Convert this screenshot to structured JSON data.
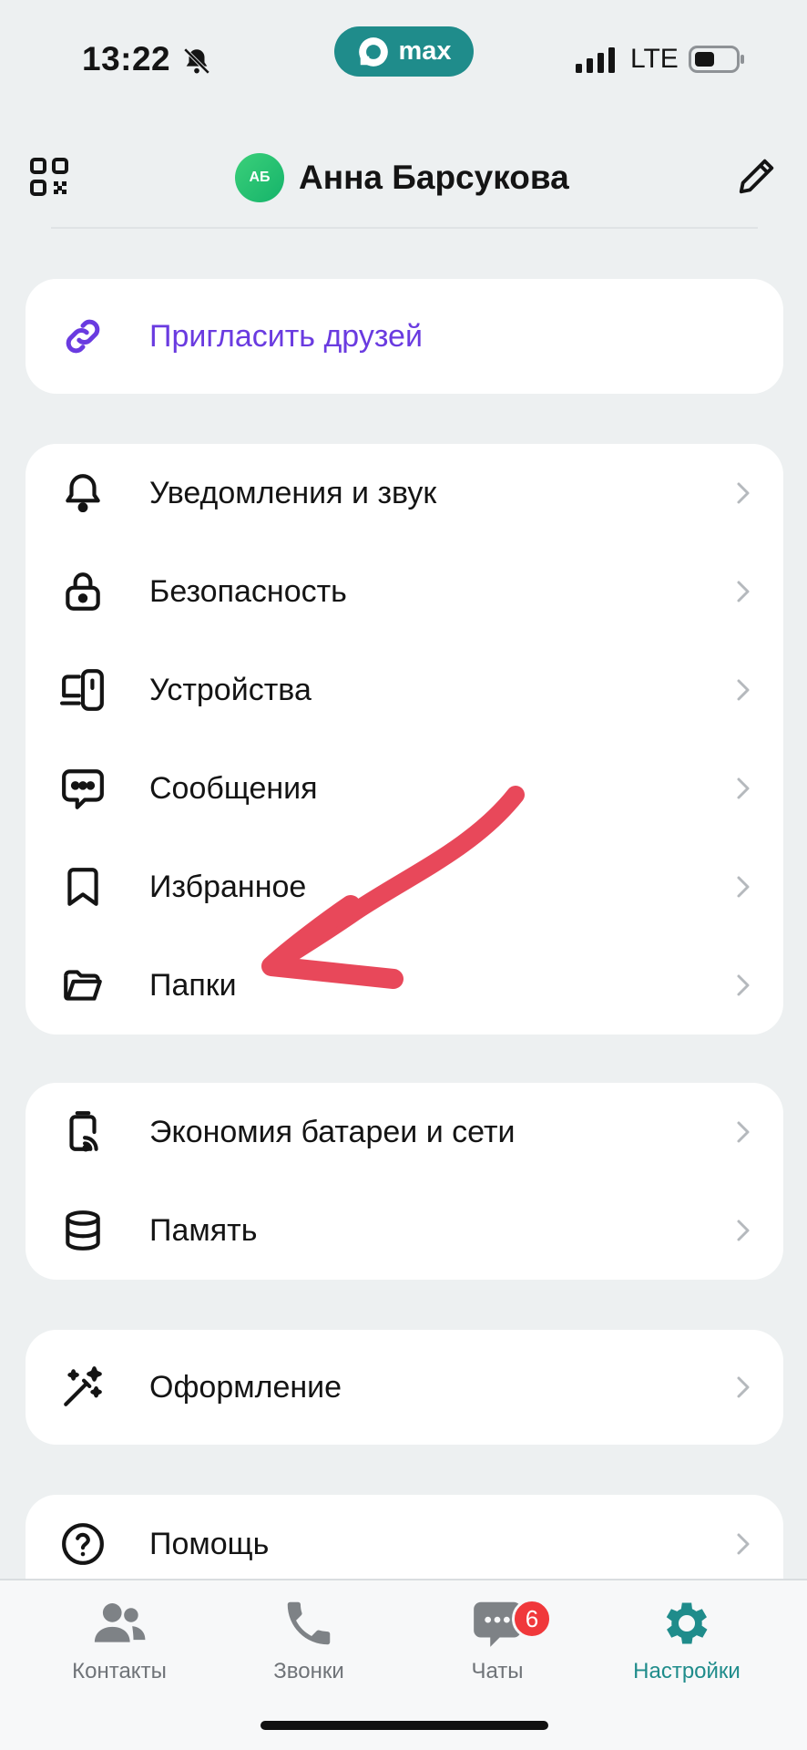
{
  "status_bar": {
    "time": "13:22",
    "app_pill_label": "max",
    "network": "LTE"
  },
  "header": {
    "avatar_initials": "АБ",
    "profile_name": "Анна Барсукова",
    "qr_icon": "qr-code-icon",
    "edit_icon": "pencil-icon"
  },
  "invite": {
    "label": "Пригласить друзей",
    "icon": "link-icon",
    "accent_color": "#6a3be0"
  },
  "settings_group_1": [
    {
      "label": "Уведомления и звук",
      "icon": "bell-icon"
    },
    {
      "label": "Безопасность",
      "icon": "lock-icon"
    },
    {
      "label": "Устройства",
      "icon": "devices-icon"
    },
    {
      "label": "Сообщения",
      "icon": "message-icon"
    },
    {
      "label": "Избранное",
      "icon": "bookmark-icon"
    },
    {
      "label": "Папки",
      "icon": "folder-icon"
    }
  ],
  "settings_group_2": [
    {
      "label": "Экономия батареи и сети",
      "icon": "battery-saver-icon"
    },
    {
      "label": "Память",
      "icon": "storage-icon"
    }
  ],
  "settings_group_3": [
    {
      "label": "Оформление",
      "icon": "magic-wand-icon"
    }
  ],
  "settings_group_4": [
    {
      "label": "Помощь",
      "icon": "help-icon"
    }
  ],
  "tab_bar": {
    "tabs": [
      {
        "label": "Контакты",
        "icon": "contacts-icon"
      },
      {
        "label": "Звонки",
        "icon": "phone-icon"
      },
      {
        "label": "Чаты",
        "icon": "chat-icon",
        "badge": "6"
      },
      {
        "label": "Настройки",
        "icon": "gear-icon",
        "active": true
      }
    ],
    "active_color": "#1f8c8b",
    "badge_color": "#f0383b"
  },
  "annotation": {
    "arrow_color": "#e8485a"
  }
}
